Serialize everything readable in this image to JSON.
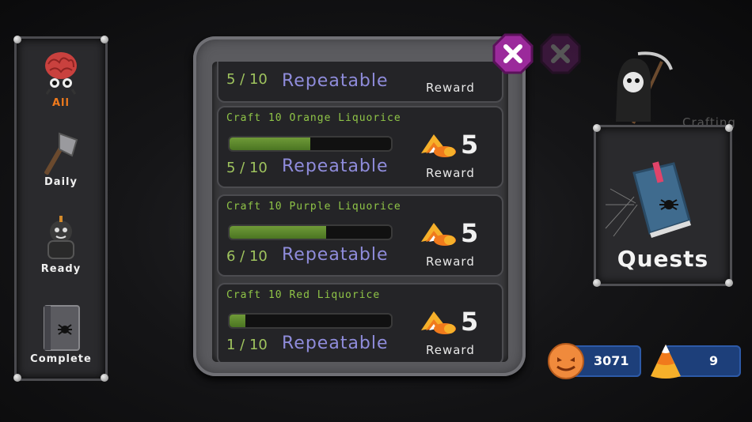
{
  "categories": [
    {
      "label": "All",
      "icon": "brain-monster-icon",
      "active": true
    },
    {
      "label": "Daily",
      "icon": "axe-icon",
      "active": false
    },
    {
      "label": "Ready",
      "icon": "cauldron-icon",
      "active": false
    },
    {
      "label": "Complete",
      "icon": "spider-book-icon",
      "active": false
    }
  ],
  "partial_quest": {
    "progress_text": "5 / 10",
    "repeat_label": "Repeatable",
    "reward_label": "Reward"
  },
  "quests": [
    {
      "title": "Craft 10 Orange Liquorice",
      "current": 5,
      "total": 10,
      "progress_text": "5 / 10",
      "progress_fraction": 0.5,
      "repeat_label": "Repeatable",
      "reward_amount": "5",
      "reward_label": "Reward",
      "reward_icon": "candy-corn-icon"
    },
    {
      "title": "Craft 10 Purple Liquorice",
      "current": 6,
      "total": 10,
      "progress_text": "6 / 10",
      "progress_fraction": 0.6,
      "repeat_label": "Repeatable",
      "reward_amount": "5",
      "reward_label": "Reward",
      "reward_icon": "candy-corn-icon"
    },
    {
      "title": "Craft 10 Red Liquorice",
      "current": 1,
      "total": 10,
      "progress_text": "1 / 10",
      "progress_fraction": 0.1,
      "repeat_label": "Repeatable",
      "reward_amount": "5",
      "reward_label": "Reward",
      "reward_icon": "candy-corn-icon"
    }
  ],
  "side": {
    "quests_label": "Quests",
    "crafting_label": "Crafting"
  },
  "currency": {
    "pumpkin_value": "3071",
    "candy_value": "9"
  },
  "colors": {
    "accent_orange": "#f07a1c",
    "quest_green": "#8fc447",
    "repeat_purple": "#8f8cdb",
    "close_purple": "#9b2a9b",
    "currency_blue": "#1d3f7a"
  }
}
